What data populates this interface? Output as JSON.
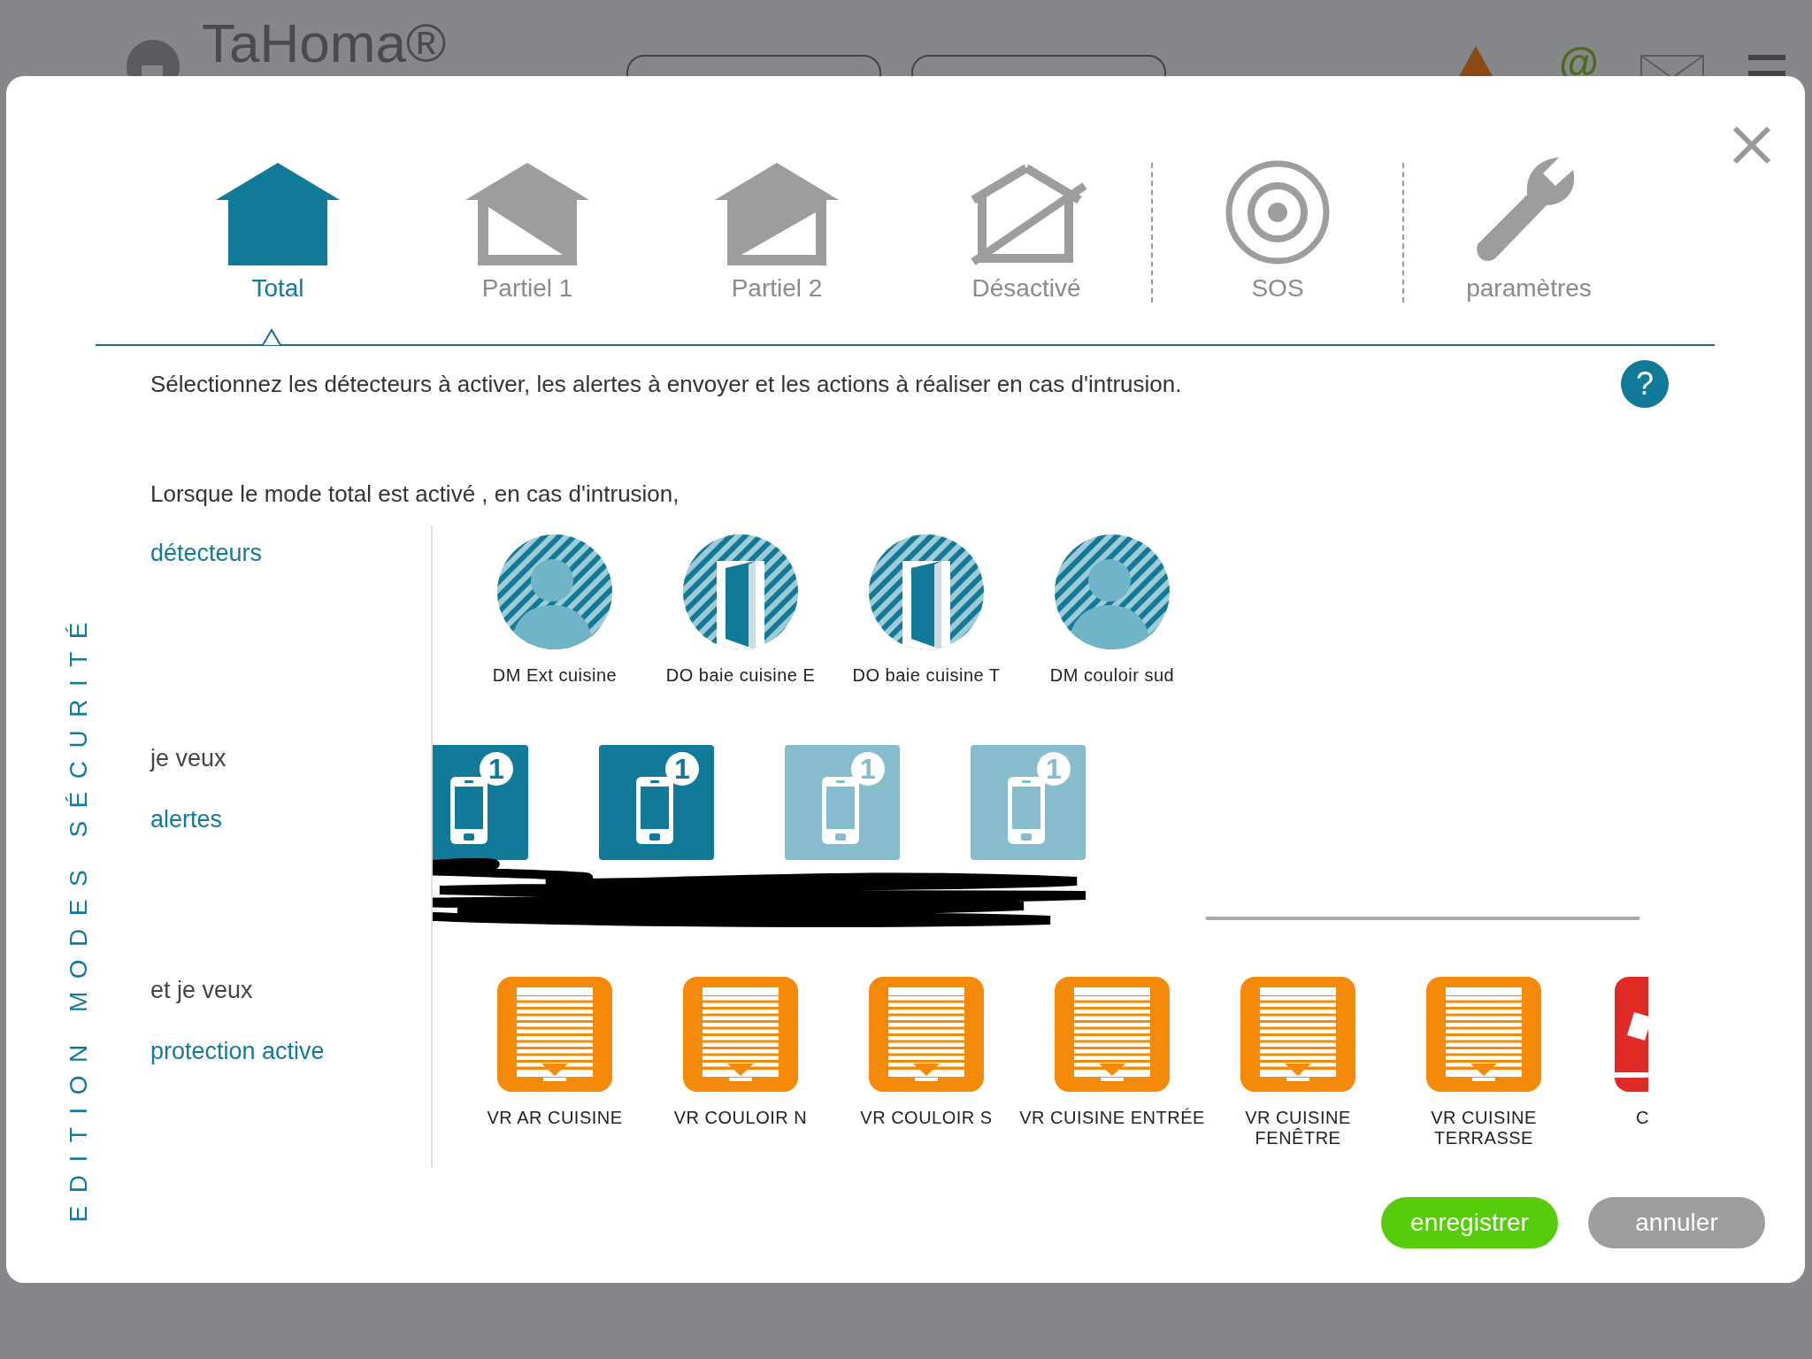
{
  "app_header": {
    "logo": "TaHoma®",
    "at_sign": "@"
  },
  "modal": {
    "side_title": "EDITION MODES SÉCURITÉ",
    "tabs": [
      {
        "label": "Total",
        "selected": true,
        "kind": "full"
      },
      {
        "label": "Partiel 1",
        "selected": false,
        "kind": "partial1"
      },
      {
        "label": "Partiel 2",
        "selected": false,
        "kind": "partial2"
      },
      {
        "label": "Désactivé",
        "selected": false,
        "kind": "off"
      },
      {
        "label": "SOS",
        "selected": false,
        "kind": "sos"
      },
      {
        "label": "paramètres",
        "selected": false,
        "kind": "settings"
      }
    ],
    "instruction": "Sélectionnez les détecteurs à activer, les alertes à envoyer et les actions à réaliser en cas d'intrusion.",
    "help": "?",
    "intro": "Lorsque le mode total est activé , en cas d'intrusion,",
    "detectors": {
      "label": "détecteurs",
      "items": [
        {
          "name": "DM Ext cuisine",
          "kind": "motion"
        },
        {
          "name": "DO baie cuisine E",
          "kind": "door"
        },
        {
          "name": "DO baie cuisine T",
          "kind": "door"
        },
        {
          "name": "DM couloir sud",
          "kind": "motion"
        }
      ]
    },
    "alerts": {
      "lead": "je veux",
      "label": "alertes",
      "items": [
        {
          "badge": "1",
          "selected": true
        },
        {
          "badge": "1",
          "selected": true
        },
        {
          "badge": "1",
          "selected": false
        },
        {
          "badge": "1",
          "selected": false
        }
      ]
    },
    "actions": {
      "lead": "et je veux",
      "label": "protection active",
      "items": [
        {
          "name": "VR AR CUISINE",
          "kind": "shutter"
        },
        {
          "name": "VR COULOIR N",
          "kind": "shutter"
        },
        {
          "name": "VR COULOIR S",
          "kind": "shutter"
        },
        {
          "name": "VR CUISINE ENTRÉE",
          "kind": "shutter"
        },
        {
          "name": "VR CUISINE FENÊTRE",
          "kind": "shutter"
        },
        {
          "name": "VR CUISINE TERRASSE",
          "kind": "shutter"
        },
        {
          "name": "C",
          "kind": "other"
        }
      ]
    },
    "buttons": [
      {
        "label": "enregistrer",
        "kind": "primary"
      },
      {
        "label": "annuler",
        "kind": "secondary"
      }
    ]
  }
}
